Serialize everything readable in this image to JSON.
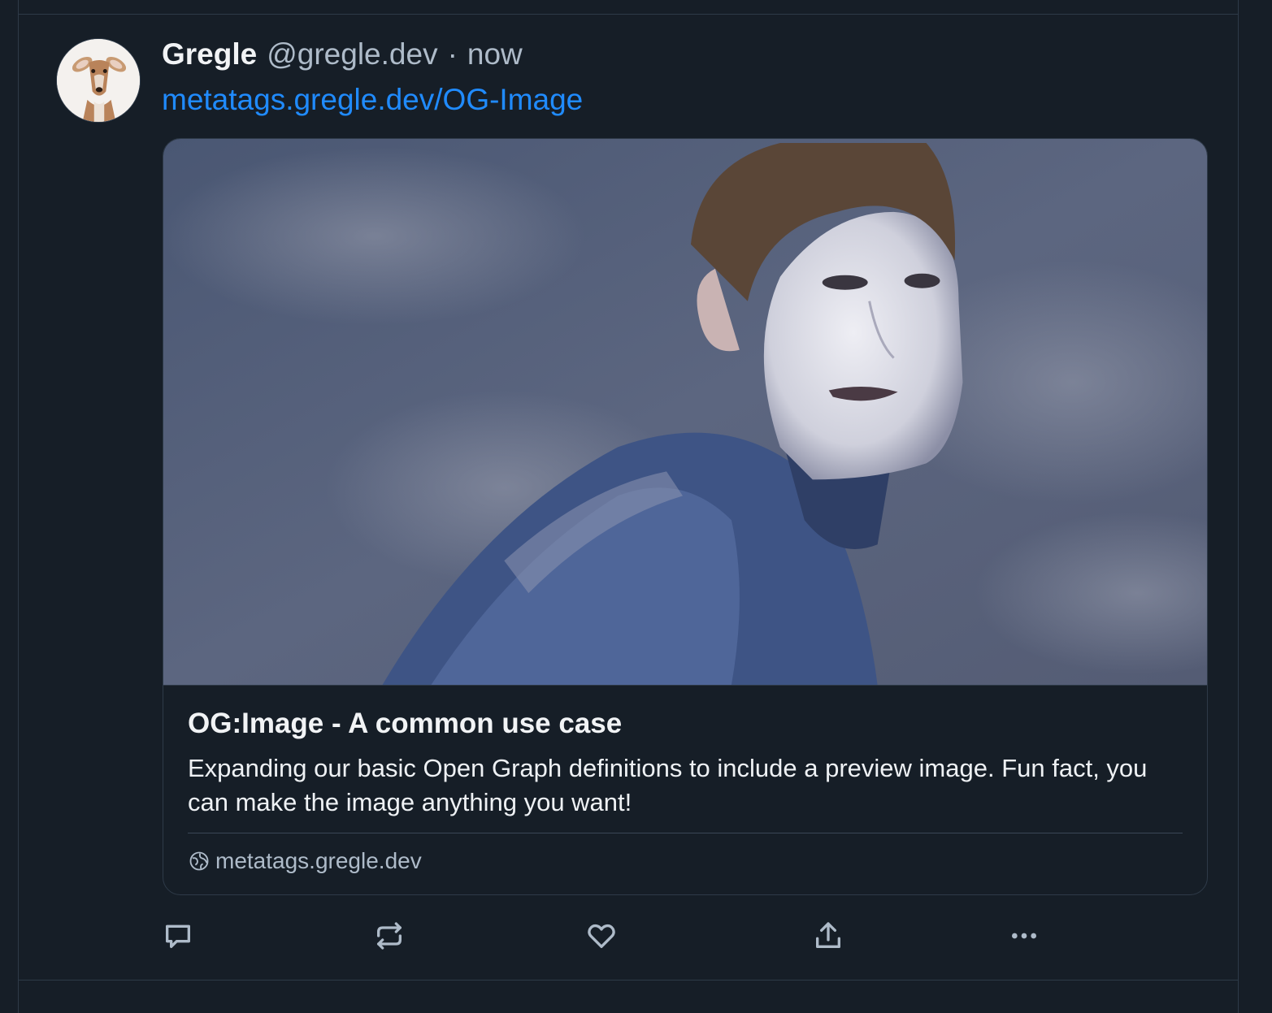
{
  "colors": {
    "background": "#161e27",
    "border": "#2e3a48",
    "text_primary": "#f1f3f5",
    "text_secondary": "#aebbc9",
    "link": "#208bfe"
  },
  "post": {
    "author_name": "Gregle",
    "handle": "@gregle.dev",
    "separator": "·",
    "timestamp": "now",
    "avatar_icon": "deer-avatar-icon",
    "link_text": "metatags.gregle.dev/OG-Image"
  },
  "card": {
    "image_icon": "preview-photo-icon",
    "title": "OG:Image - A common use case",
    "description": "Expanding our basic Open Graph definitions to include a preview image. Fun fact, you can make the image anything you want!",
    "domain_icon": "globe-icon",
    "domain": "metatags.gregle.dev"
  },
  "actions": [
    {
      "name": "reply",
      "icon": "comment-icon"
    },
    {
      "name": "repost",
      "icon": "repost-icon"
    },
    {
      "name": "like",
      "icon": "heart-icon"
    },
    {
      "name": "share",
      "icon": "share-icon"
    },
    {
      "name": "more",
      "icon": "ellipsis-icon"
    }
  ]
}
